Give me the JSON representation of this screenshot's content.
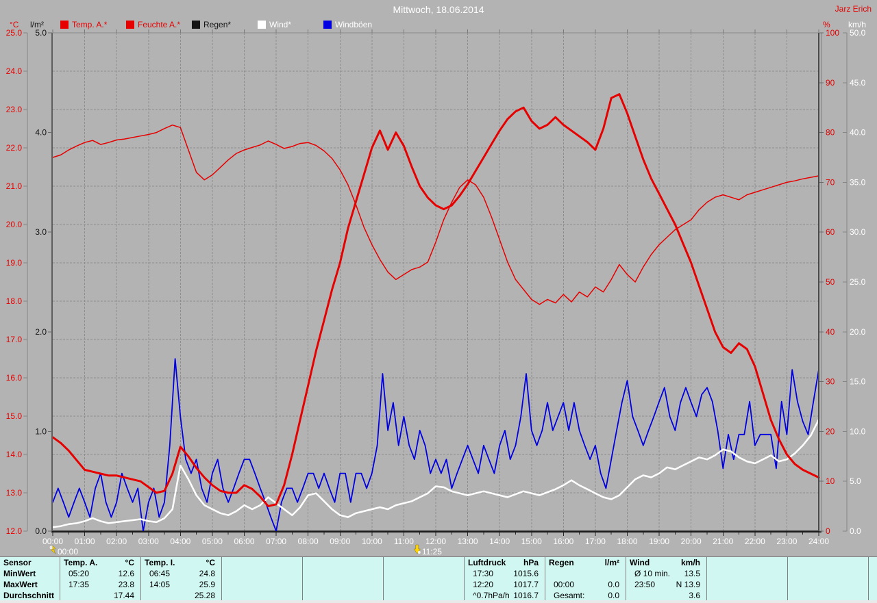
{
  "header": {
    "title": "Mittwoch, 18.06.2014",
    "owner": "Jarz Erich"
  },
  "legend": {
    "items": [
      {
        "label": "Temp. A.*",
        "swatch": "#e60000",
        "label_color": "#e60000"
      },
      {
        "label": "Feuchte A.*",
        "swatch": "#e60000",
        "label_color": "#e60000"
      },
      {
        "label": "Regen*",
        "swatch": "#141414",
        "label_color": "#141414"
      },
      {
        "label": "Wind*",
        "swatch": "#ffffff",
        "label_color": "#ffffff"
      },
      {
        "label": "Windböen",
        "swatch": "#0000e0",
        "label_color": "#ffffff"
      }
    ]
  },
  "chart_data": {
    "type": "line",
    "title": "Mittwoch, 18.06.2014",
    "grid": true,
    "x_axis": {
      "range_hours": [
        0,
        24
      ],
      "tick_labels": [
        "00:00",
        "01:00",
        "02:00",
        "03:00",
        "04:00",
        "05:00",
        "06:00",
        "07:00",
        "08:00",
        "09:00",
        "10:00",
        "11:00",
        "12:00",
        "13:00",
        "14:00",
        "15:00",
        "16:00",
        "17:00",
        "18:00",
        "19:00",
        "20:00",
        "21:00",
        "22:00",
        "23:00",
        "24:00"
      ]
    },
    "axes": {
      "temp_c": {
        "unit": "°C",
        "min": 12,
        "max": 25,
        "color": "#e60000",
        "side": "left-outer",
        "tick_labels": [
          "25.0",
          "24.0",
          "23.0",
          "22.0",
          "21.0",
          "20.0",
          "19.0",
          "18.0",
          "17.0",
          "16.0",
          "15.0",
          "14.0",
          "13.0",
          "12.0"
        ]
      },
      "rain_lm2": {
        "unit": "l/m²",
        "min": 0,
        "max": 5,
        "color": "#141414",
        "side": "left-inner",
        "tick_labels": [
          "5.0",
          "4.0",
          "3.0",
          "2.0",
          "1.0",
          "0.0"
        ]
      },
      "humidity_pct": {
        "unit": "%",
        "min": 0,
        "max": 100,
        "color": "#e60000",
        "side": "right-inner",
        "tick_labels": [
          "100",
          "90",
          "80",
          "70",
          "60",
          "50",
          "40",
          "30",
          "20",
          "10",
          "0"
        ]
      },
      "wind_kmh": {
        "unit": "km/h",
        "min": 0,
        "max": 50,
        "color": "#ffffff",
        "side": "right-outer",
        "tick_labels": [
          "50.0",
          "45.0",
          "40.0",
          "35.0",
          "30.0",
          "25.0",
          "20.0",
          "15.0",
          "10.0",
          "5.0",
          "0.0"
        ]
      }
    },
    "series": [
      {
        "id": "temp-a",
        "name": "Temp. A.*",
        "axis": "temp_c",
        "color": "#e60000",
        "width": 3,
        "interval_min": 15,
        "values": [
          14.45,
          14.3,
          14.1,
          13.85,
          13.6,
          13.55,
          13.5,
          13.45,
          13.45,
          13.4,
          13.35,
          13.3,
          13.15,
          13.0,
          13.05,
          13.5,
          14.2,
          13.95,
          13.65,
          13.4,
          13.2,
          13.05,
          13.0,
          13.0,
          13.2,
          13.1,
          12.9,
          12.65,
          12.7,
          13.2,
          14.0,
          14.9,
          15.8,
          16.7,
          17.5,
          18.3,
          19.0,
          19.9,
          20.6,
          21.3,
          22.0,
          22.45,
          21.95,
          22.4,
          22.05,
          21.5,
          21.0,
          20.7,
          20.5,
          20.4,
          20.5,
          20.75,
          21.05,
          21.4,
          21.75,
          22.1,
          22.45,
          22.75,
          22.95,
          23.05,
          22.7,
          22.5,
          22.6,
          22.8,
          22.6,
          22.45,
          22.3,
          22.15,
          21.95,
          22.5,
          23.3,
          23.4,
          22.9,
          22.3,
          21.7,
          21.2,
          20.8,
          20.4,
          20.0,
          19.5,
          19.0,
          18.4,
          17.8,
          17.2,
          16.8,
          16.65,
          16.9,
          16.75,
          16.3,
          15.6,
          14.9,
          14.4,
          14.0,
          13.75,
          13.6,
          13.5,
          13.4
        ]
      },
      {
        "id": "feuchte-a",
        "name": "Feuchte A.*",
        "axis": "humidity_pct",
        "color": "#e60000",
        "width": 1.5,
        "interval_min": 15,
        "values": [
          75.0,
          75.5,
          76.5,
          77.3,
          78.0,
          78.4,
          77.6,
          78.0,
          78.5,
          78.7,
          79.0,
          79.3,
          79.6,
          80.0,
          80.8,
          81.5,
          81.0,
          76.5,
          72.0,
          70.5,
          71.5,
          73.0,
          74.5,
          75.8,
          76.5,
          77.0,
          77.5,
          78.3,
          77.6,
          76.8,
          77.2,
          77.8,
          78.0,
          77.4,
          76.3,
          74.8,
          72.5,
          69.5,
          65.5,
          61.0,
          57.5,
          54.5,
          52.0,
          50.5,
          51.5,
          52.5,
          53.0,
          54.0,
          58.0,
          62.5,
          66.0,
          69.0,
          70.5,
          69.5,
          67.0,
          63.0,
          58.5,
          54.0,
          50.5,
          48.5,
          46.5,
          45.5,
          46.5,
          45.8,
          47.5,
          46.0,
          48.0,
          47.0,
          49.0,
          48.0,
          50.5,
          53.5,
          51.5,
          50.0,
          53.0,
          55.5,
          57.5,
          59.0,
          60.5,
          61.5,
          62.5,
          64.5,
          66.0,
          67.0,
          67.5,
          67.0,
          66.5,
          67.5,
          68.0,
          68.5,
          69.0,
          69.5,
          70.0,
          70.3,
          70.7,
          71.0,
          71.3
        ]
      },
      {
        "id": "regen",
        "name": "Regen*",
        "axis": "rain_lm2",
        "color": "#141414",
        "width": 1.5,
        "interval_min": 60,
        "values": [
          0,
          0,
          0,
          0,
          0,
          0,
          0,
          0,
          0,
          0,
          0,
          0,
          0,
          0,
          0,
          0,
          0,
          0,
          0,
          0,
          0,
          0,
          0,
          0,
          0
        ]
      },
      {
        "id": "wind",
        "name": "Wind*",
        "axis": "wind_kmh",
        "color": "#ffffff",
        "width": 2.5,
        "interval_min": 15,
        "values": [
          0.4,
          0.5,
          0.7,
          0.8,
          1.0,
          1.3,
          1.0,
          0.8,
          0.9,
          1.0,
          1.1,
          1.2,
          1.0,
          0.9,
          1.3,
          2.2,
          6.6,
          5.2,
          3.6,
          2.6,
          2.2,
          1.8,
          1.6,
          2.0,
          2.6,
          2.2,
          2.6,
          3.4,
          2.8,
          2.2,
          1.6,
          2.4,
          3.6,
          3.8,
          3.0,
          2.2,
          1.6,
          1.4,
          1.8,
          2.0,
          2.2,
          2.4,
          2.2,
          2.6,
          2.8,
          3.0,
          3.4,
          3.8,
          4.5,
          4.4,
          4.0,
          3.8,
          3.6,
          3.8,
          4.0,
          3.8,
          3.6,
          3.4,
          3.7,
          4.0,
          3.8,
          3.6,
          3.9,
          4.2,
          4.6,
          5.1,
          4.6,
          4.2,
          3.8,
          3.4,
          3.2,
          3.6,
          4.4,
          5.2,
          5.6,
          5.4,
          5.8,
          6.4,
          6.2,
          6.6,
          7.0,
          7.4,
          7.2,
          7.6,
          8.2,
          8.0,
          7.4,
          7.0,
          6.8,
          7.2,
          7.6,
          7.0,
          7.2,
          7.8,
          8.6,
          9.6,
          11.2
        ]
      },
      {
        "id": "windboeen",
        "name": "Windböen",
        "axis": "wind_kmh",
        "color": "#0000e0",
        "width": 1.8,
        "interval_min": 10,
        "values": [
          2.9,
          4.3,
          2.9,
          1.4,
          2.9,
          4.3,
          2.9,
          1.4,
          4.3,
          5.8,
          2.9,
          1.4,
          2.9,
          5.8,
          4.3,
          2.9,
          4.3,
          0.0,
          2.9,
          4.3,
          1.4,
          2.9,
          8.6,
          17.3,
          11.5,
          7.2,
          5.8,
          7.2,
          4.3,
          2.9,
          5.8,
          7.2,
          4.3,
          2.9,
          4.3,
          5.8,
          7.2,
          7.2,
          5.8,
          4.3,
          2.9,
          1.4,
          0.0,
          2.9,
          4.3,
          4.3,
          2.9,
          4.3,
          5.8,
          5.8,
          4.3,
          5.8,
          4.3,
          2.9,
          5.8,
          5.8,
          2.9,
          5.8,
          5.8,
          4.3,
          5.8,
          8.6,
          15.8,
          10.1,
          12.9,
          8.6,
          11.5,
          8.6,
          7.2,
          10.1,
          8.6,
          5.8,
          7.2,
          5.8,
          7.2,
          4.3,
          5.8,
          7.2,
          8.6,
          7.2,
          5.8,
          8.6,
          7.2,
          5.8,
          8.6,
          10.1,
          7.2,
          8.6,
          11.5,
          15.8,
          10.1,
          8.6,
          10.1,
          12.9,
          10.1,
          11.5,
          12.9,
          10.1,
          12.9,
          10.1,
          8.6,
          7.2,
          8.6,
          5.8,
          4.3,
          7.2,
          10.1,
          12.9,
          15.1,
          11.5,
          10.1,
          8.6,
          10.1,
          11.5,
          13.0,
          14.4,
          11.5,
          10.1,
          12.9,
          14.4,
          12.9,
          11.5,
          13.7,
          14.4,
          13.0,
          10.1,
          6.3,
          9.7,
          7.2,
          9.7,
          9.7,
          13.0,
          8.6,
          9.7,
          9.7,
          9.7,
          6.3,
          13.0,
          9.7,
          16.2,
          13.0,
          11.0,
          9.7,
          13.0,
          16.2
        ]
      }
    ],
    "markers": [
      {
        "label": "00:00",
        "t": 0,
        "icon": "flash"
      },
      {
        "label": "11:25",
        "t": 11.4167,
        "icon": "down-arrow"
      }
    ]
  },
  "table": {
    "row_labels": [
      "Sensor",
      "MinWert",
      "MaxWert",
      "Durchschnitt"
    ],
    "columns": [
      {
        "id": "temp-a",
        "name": "Temp. A.",
        "unit": "°C",
        "rows": [
          [
            "05:20",
            "12.6"
          ],
          [
            "17:35",
            "23.8"
          ],
          [
            "",
            "17.44"
          ]
        ]
      },
      {
        "id": "temp-i",
        "name": "Temp. I.",
        "unit": "°C",
        "rows": [
          [
            "06:45",
            "24.8"
          ],
          [
            "14:05",
            "25.9"
          ],
          [
            "",
            "25.28"
          ]
        ]
      },
      {
        "id": "empty-1",
        "name": "",
        "unit": "",
        "rows": [
          [
            "",
            ""
          ],
          [
            "",
            ""
          ],
          [
            "",
            ""
          ]
        ]
      },
      {
        "id": "empty-2",
        "name": "",
        "unit": "",
        "rows": [
          [
            "",
            ""
          ],
          [
            "",
            ""
          ],
          [
            "",
            ""
          ]
        ]
      },
      {
        "id": "empty-3",
        "name": "",
        "unit": "",
        "rows": [
          [
            "",
            ""
          ],
          [
            "",
            ""
          ],
          [
            "",
            ""
          ]
        ]
      },
      {
        "id": "luftdruck",
        "name": "Luftdruck",
        "unit": "hPa",
        "rows": [
          [
            "17:30",
            "1015.6"
          ],
          [
            "12:20",
            "1017.7"
          ],
          [
            "^0.7hPa/h",
            "1016.7"
          ]
        ]
      },
      {
        "id": "regen",
        "name": "Regen",
        "unit": "l/m²",
        "rows": [
          [
            "",
            ""
          ],
          [
            "00:00",
            "0.0"
          ],
          [
            "Gesamt:",
            "0.0"
          ]
        ]
      },
      {
        "id": "wind",
        "name": "Wind",
        "unit": "km/h",
        "rows": [
          [
            "Ø 10 min.",
            "13.5"
          ],
          [
            "23:50",
            "N 13.9"
          ],
          [
            "",
            "3.6"
          ]
        ]
      },
      {
        "id": "empty-4",
        "name": "",
        "unit": "",
        "rows": [
          [
            "",
            ""
          ],
          [
            "",
            ""
          ],
          [
            "",
            ""
          ]
        ]
      },
      {
        "id": "empty-5",
        "name": "",
        "unit": "",
        "rows": [
          [
            "",
            ""
          ],
          [
            "",
            ""
          ],
          [
            "",
            ""
          ]
        ]
      }
    ]
  }
}
